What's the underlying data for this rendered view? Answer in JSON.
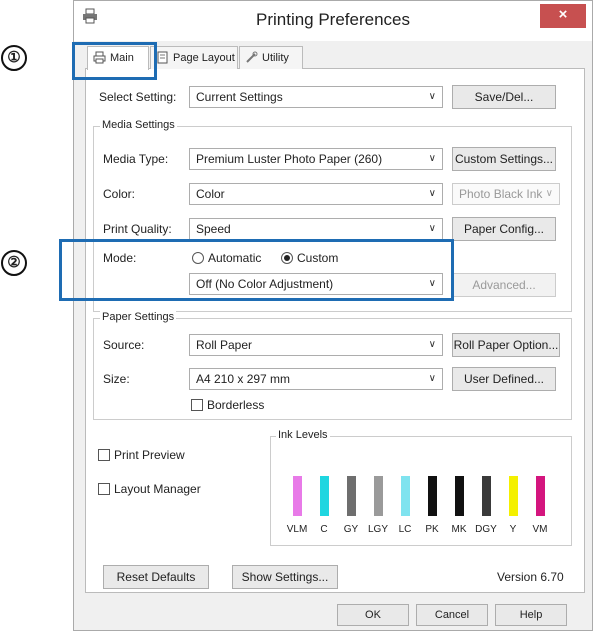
{
  "window": {
    "title": "Printing Preferences",
    "close_label": "×"
  },
  "tabs": [
    {
      "label": "Main",
      "icon": "printer-icon"
    },
    {
      "label": "Page Layout",
      "icon": "page-layout-icon"
    },
    {
      "label": "Utility",
      "icon": "wrench-icon"
    }
  ],
  "callouts": [
    "①",
    "②"
  ],
  "select_setting": {
    "label": "Select Setting:",
    "value": "Current Settings",
    "button": "Save/Del..."
  },
  "media_settings": {
    "group_label": "Media Settings",
    "media_type": {
      "label": "Media Type:",
      "value": "Premium Luster Photo Paper (260)",
      "button": "Custom Settings..."
    },
    "color": {
      "label": "Color:",
      "value": "Color",
      "ink_value": "Photo Black Ink"
    },
    "print_quality": {
      "label": "Print Quality:",
      "value": "Speed",
      "button": "Paper Config..."
    },
    "mode": {
      "label": "Mode:",
      "option_automatic": "Automatic",
      "option_custom": "Custom",
      "selected": "Custom",
      "value": "Off (No Color Adjustment)",
      "button": "Advanced..."
    }
  },
  "paper_settings": {
    "group_label": "Paper Settings",
    "source": {
      "label": "Source:",
      "value": "Roll Paper",
      "button": "Roll Paper Option..."
    },
    "size": {
      "label": "Size:",
      "value": "A4 210 x 297 mm",
      "button": "User Defined..."
    },
    "borderless": {
      "label": "Borderless",
      "checked": false
    }
  },
  "print_preview": {
    "label": "Print Preview",
    "checked": false
  },
  "layout_manager": {
    "label": "Layout Manager",
    "checked": false
  },
  "ink_levels": {
    "label": "Ink Levels",
    "inks": [
      {
        "name": "VLM",
        "color": "#e87ae8",
        "level": 0.62
      },
      {
        "name": "C",
        "color": "#1fd6e0",
        "level": 0.62
      },
      {
        "name": "GY",
        "color": "#6e6e6e",
        "level": 0.62
      },
      {
        "name": "LGY",
        "color": "#9a9a9a",
        "level": 0.62
      },
      {
        "name": "LC",
        "color": "#7fe3ef",
        "level": 0.62
      },
      {
        "name": "PK",
        "color": "#111111",
        "level": 0.62
      },
      {
        "name": "MK",
        "color": "#111111",
        "level": 0.62
      },
      {
        "name": "DGY",
        "color": "#3a3a3a",
        "level": 0.62
      },
      {
        "name": "Y",
        "color": "#f4f000",
        "level": 0.62
      },
      {
        "name": "VM",
        "color": "#d4157e",
        "level": 0.62
      }
    ]
  },
  "footer": {
    "reset_defaults": "Reset Defaults",
    "show_settings": "Show Settings...",
    "version": "Version 6.70"
  },
  "dialog_buttons": {
    "ok": "OK",
    "cancel": "Cancel",
    "help": "Help"
  },
  "colors": {
    "highlight": "#1e6cb3",
    "close_button": "#c75050"
  }
}
